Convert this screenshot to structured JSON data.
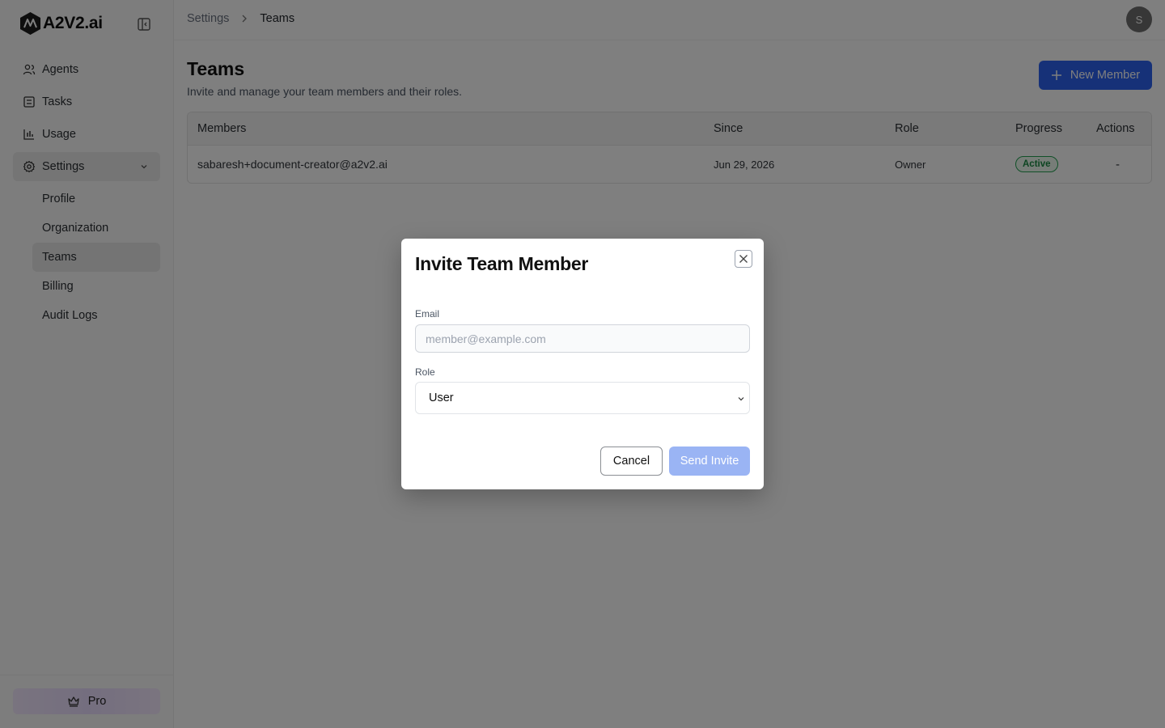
{
  "brand": {
    "name": "A2V2.ai"
  },
  "sidebar": {
    "items": [
      {
        "label": "Agents",
        "icon": "users-icon"
      },
      {
        "label": "Tasks",
        "icon": "tasks-icon"
      },
      {
        "label": "Usage",
        "icon": "bar-chart-icon"
      },
      {
        "label": "Settings",
        "icon": "gear-icon"
      }
    ],
    "settings_sub": [
      "Profile",
      "Organization",
      "Teams",
      "Billing",
      "Audit Logs"
    ],
    "active_sub": "Teams",
    "pro_label": "Pro"
  },
  "header": {
    "breadcrumb": [
      "Settings",
      "Teams"
    ],
    "avatar_initial": "S"
  },
  "page": {
    "title": "Teams",
    "subtitle": "Invite and manage your team members and their roles.",
    "new_member_label": "New Member"
  },
  "table": {
    "columns": [
      "Members",
      "Since",
      "Role",
      "Progress",
      "Actions"
    ],
    "rows": [
      {
        "member": "sabaresh+document-creator@a2v2.ai",
        "since": "Jun 29, 2026",
        "role": "Owner",
        "progress": "Active",
        "actions": "-"
      }
    ]
  },
  "modal": {
    "title": "Invite Team Member",
    "email_label": "Email",
    "email_placeholder": "member@example.com",
    "email_value": "",
    "role_label": "Role",
    "role_value": "User",
    "cancel_label": "Cancel",
    "send_label": "Send Invite"
  },
  "colors": {
    "primary": "#2d63f0",
    "primary_disabled": "#9ab4f4",
    "active_green": "#1a8a43"
  }
}
